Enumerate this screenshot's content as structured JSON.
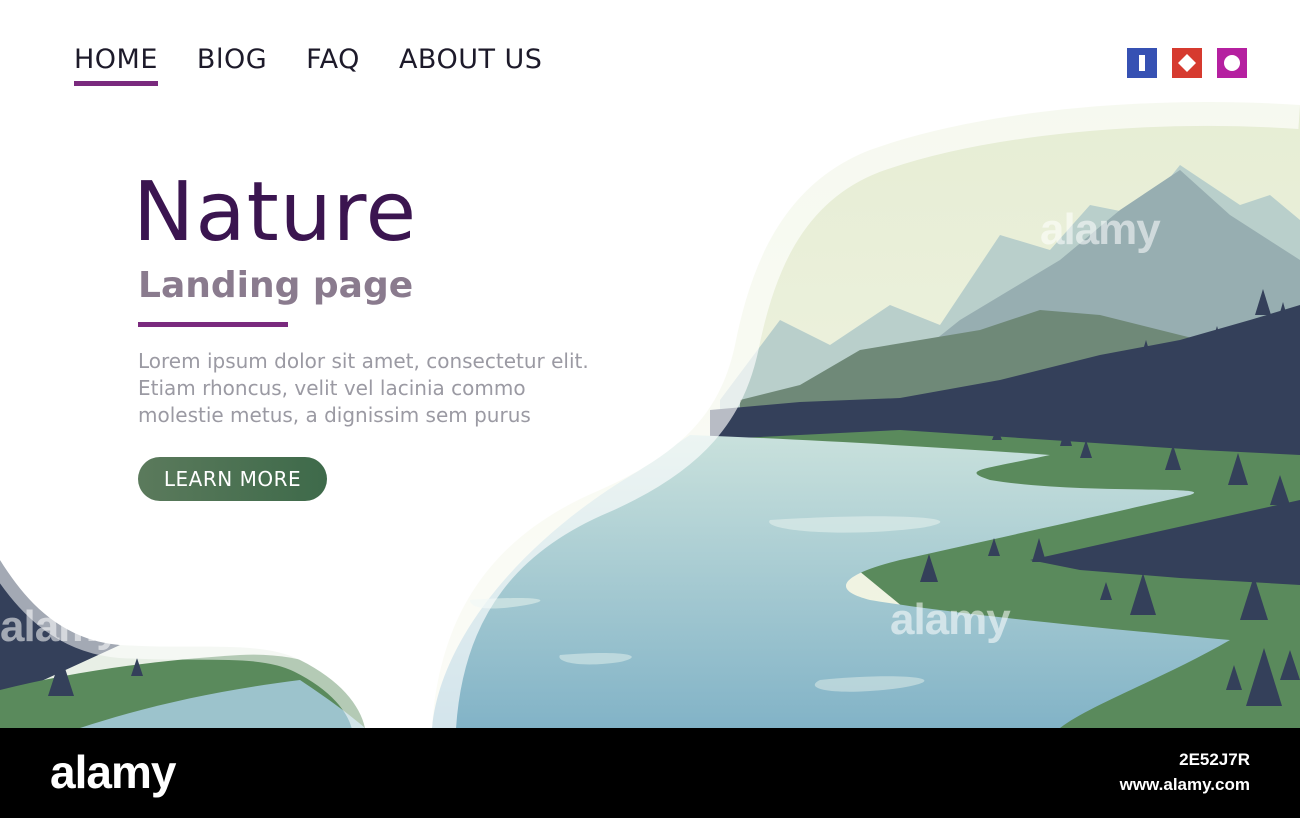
{
  "nav": {
    "items": [
      {
        "label": "HOME",
        "active": true
      },
      {
        "label": "BlOG",
        "active": false
      },
      {
        "label": "FAQ",
        "active": false
      },
      {
        "label": "ABOUT US",
        "active": false
      }
    ],
    "accent": "#7a2a7e"
  },
  "social": [
    {
      "icon": "bar-icon",
      "color": "#3651b3"
    },
    {
      "icon": "diamond-icon",
      "color": "#d63a2f"
    },
    {
      "icon": "circle-icon",
      "color": "#b520a0"
    }
  ],
  "hero": {
    "title": "Nature",
    "subtitle": "Landing page",
    "body": "Lorem ipsum dolor sit amet, consectetur elit. Etiam rhoncus, velit vel lacinia commo molestie metus, a dignissim sem purus",
    "cta": "LEARN MORE",
    "title_color": "#3b1550"
  },
  "watermark": {
    "brand": "alamy",
    "image_id": "2E52J7R",
    "url": "www.alamy.com"
  }
}
